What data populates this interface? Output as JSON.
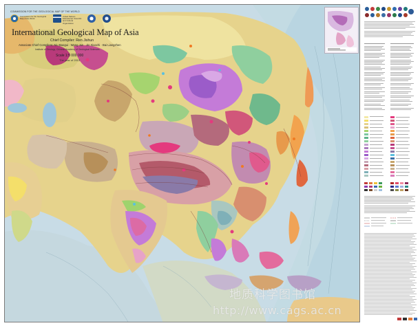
{
  "map": {
    "title": "International Geological Map of Asia",
    "chief_compiler": "Chief Compiler: Ren Jishun",
    "associates": "Associate Chief Compilers: Niu Baogui · Wang Jun · Jin Xiaochi · Bai Liangzhen",
    "institute": "Institute of Geology, Chinese Academy of Geological Sciences",
    "scale": "Scale 1:5 000 000",
    "year": "The year of 2013",
    "top_strip": "COMMISSION FOR THE GEOLOGICAL MAP OF THE WORLD",
    "logo_texts": [
      "Commission for the Geological Map of the World",
      "United Nations Educational, Scientific and Cultural Organization"
    ],
    "icons": [
      "cgmw-logo-icon",
      "unesco-logo-icon",
      "cags-logo-icon",
      "sinoprobe-logo-icon"
    ],
    "colors": {
      "ocean_deep": "#bfd9e8",
      "ocean_shelf": "#cfe0d3",
      "continent_base": "#e6d38c",
      "quaternary": "#f3e9a8",
      "mesozoic": "#7dc7a0",
      "paleozoic": "#c2a2cf",
      "precambrian": "#c47bd8",
      "granite": "#e43a7e",
      "volcanic": "#f2a34e",
      "tertiary": "#f4df6a"
    }
  },
  "watermark": {
    "cn": "地质科学图书馆",
    "url": "http://www.cags.ac.cn"
  }
}
